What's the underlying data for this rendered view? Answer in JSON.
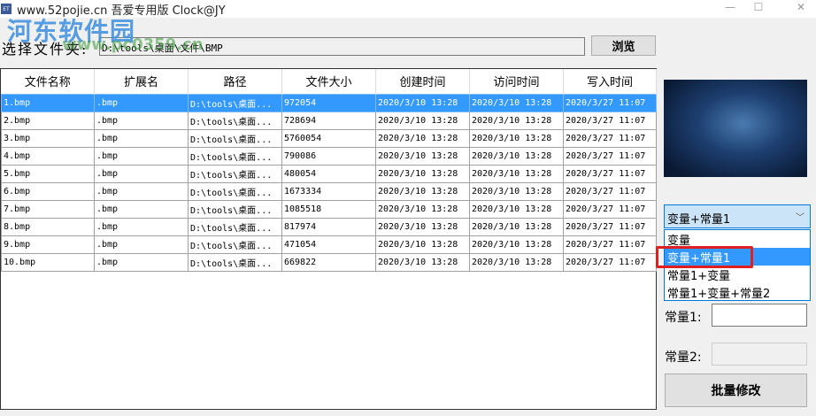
{
  "window": {
    "title": "www.52pojie.cn 吾爱专用版    Clock@JY",
    "icon": "ET"
  },
  "watermark": {
    "text1": "河东软件园",
    "text2": "www.pc0359.cn"
  },
  "folder": {
    "label": "选择文件夹:",
    "value": "D:\\tools\\桌面\\文件\\BMP",
    "browse_label": "浏览"
  },
  "table": {
    "columns": [
      "文件名称",
      "扩展名",
      "路径",
      "文件大小",
      "创建时间",
      "访问时间",
      "写入时间"
    ],
    "selected_row": 0,
    "rows": [
      [
        "1.bmp",
        ".bmp",
        "D:\\tools\\桌面...",
        "972054",
        "2020/3/10 13:28",
        "2020/3/10 13:28",
        "2020/3/27 11:07"
      ],
      [
        "2.bmp",
        ".bmp",
        "D:\\tools\\桌面...",
        "728694",
        "2020/3/10 13:28",
        "2020/3/10 13:28",
        "2020/3/27 11:07"
      ],
      [
        "3.bmp",
        ".bmp",
        "D:\\tools\\桌面...",
        "5760054",
        "2020/3/10 13:28",
        "2020/3/10 13:28",
        "2020/3/27 11:07"
      ],
      [
        "4.bmp",
        ".bmp",
        "D:\\tools\\桌面...",
        "790086",
        "2020/3/10 13:28",
        "2020/3/10 13:28",
        "2020/3/27 11:07"
      ],
      [
        "5.bmp",
        ".bmp",
        "D:\\tools\\桌面...",
        "480054",
        "2020/3/10 13:28",
        "2020/3/10 13:28",
        "2020/3/27 11:07"
      ],
      [
        "6.bmp",
        ".bmp",
        "D:\\tools\\桌面...",
        "1673334",
        "2020/3/10 13:28",
        "2020/3/10 13:28",
        "2020/3/27 11:07"
      ],
      [
        "7.bmp",
        ".bmp",
        "D:\\tools\\桌面...",
        "1085518",
        "2020/3/10 13:28",
        "2020/3/10 13:28",
        "2020/3/27 11:07"
      ],
      [
        "8.bmp",
        ".bmp",
        "D:\\tools\\桌面...",
        "817974",
        "2020/3/10 13:28",
        "2020/3/10 13:28",
        "2020/3/27 11:07"
      ],
      [
        "9.bmp",
        ".bmp",
        "D:\\tools\\桌面...",
        "471054",
        "2020/3/10 13:28",
        "2020/3/10 13:28",
        "2020/3/27 11:07"
      ],
      [
        "10.bmp",
        ".bmp",
        "D:\\tools\\桌面...",
        "669822",
        "2020/3/10 13:28",
        "2020/3/10 13:28",
        "2020/3/27 11:07"
      ]
    ]
  },
  "mode": {
    "selected": "变量+常量1",
    "options": [
      "变量",
      "变量+常量1",
      "常量1+变量",
      "常量1+变量+常量2"
    ],
    "highlighted": 1
  },
  "const1": {
    "label": "常量1:",
    "value": ""
  },
  "const2": {
    "label": "常量2:",
    "value": ""
  },
  "batch_label": "批量修改",
  "colors": {
    "selection": "#3399ff",
    "highlight_box": "#e02020"
  }
}
